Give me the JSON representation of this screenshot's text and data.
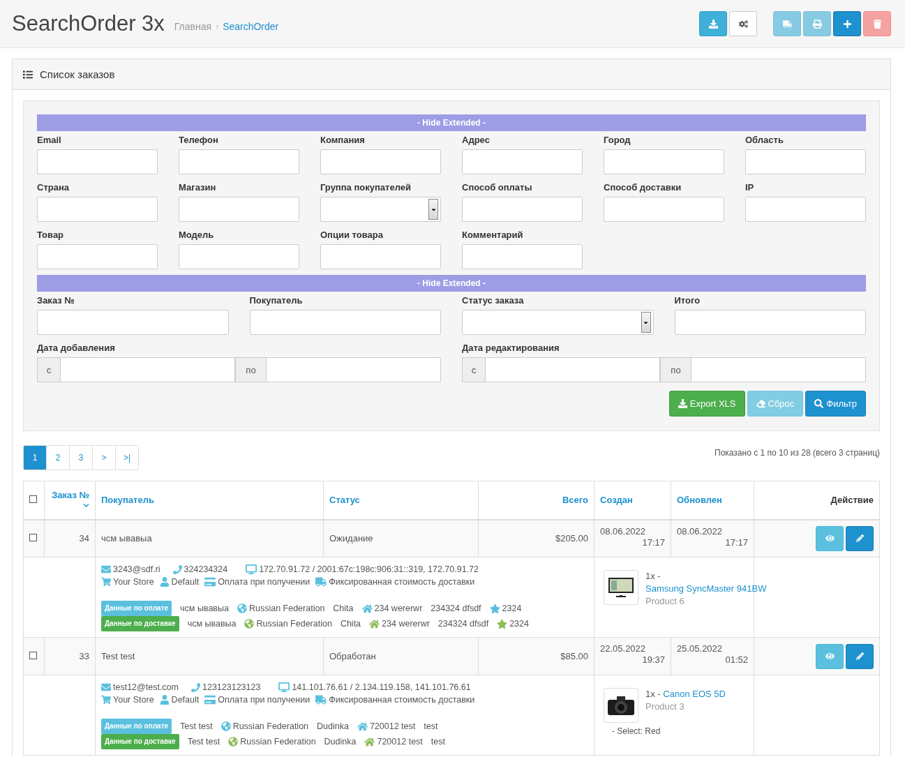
{
  "header": {
    "title": "SearchOrder 3x",
    "breadcrumbs": [
      {
        "label": "Главная",
        "current": false
      },
      {
        "label": "SearchOrder",
        "current": true
      }
    ],
    "separator": "›",
    "toolbar": [
      {
        "kind": "download",
        "disabled": false
      },
      {
        "kind": "settings",
        "disabled": false
      },
      {
        "kind": "shipping",
        "disabled": true
      },
      {
        "kind": "print",
        "disabled": true
      },
      {
        "kind": "add",
        "disabled": false
      },
      {
        "kind": "delete",
        "disabled": true
      }
    ]
  },
  "panel": {
    "title": "Список заказов"
  },
  "filter": {
    "toggles": [
      "- Hide Extended -",
      "- Hide Extended -"
    ],
    "extended_fields": [
      {
        "label": "Email",
        "kind": "text"
      },
      {
        "label": "Телефон",
        "kind": "text"
      },
      {
        "label": "Компания",
        "kind": "text"
      },
      {
        "label": "Адрес",
        "kind": "text"
      },
      {
        "label": "Город",
        "kind": "text"
      },
      {
        "label": "Область",
        "kind": "text"
      },
      {
        "label": "Страна",
        "kind": "text"
      },
      {
        "label": "Магазин",
        "kind": "text"
      },
      {
        "label": "Группа покупателей",
        "kind": "select"
      },
      {
        "label": "Способ оплаты",
        "kind": "text"
      },
      {
        "label": "Способ доставки",
        "kind": "text"
      },
      {
        "label": "IP",
        "kind": "text"
      },
      {
        "label": "Товар",
        "kind": "text"
      },
      {
        "label": "Модель",
        "kind": "text"
      },
      {
        "label": "Опции товара",
        "kind": "text"
      },
      {
        "label": "Комментарий",
        "kind": "text"
      }
    ],
    "main_fields": [
      {
        "label": "Заказ №",
        "kind": "text"
      },
      {
        "label": "Покупатель",
        "kind": "text"
      },
      {
        "label": "Статус заказа",
        "kind": "select"
      },
      {
        "label": "Итого",
        "kind": "text"
      }
    ],
    "date_ranges": [
      {
        "label": "Дата добавления",
        "from": "с",
        "to": "по"
      },
      {
        "label": "Дата редактирования",
        "from": "с",
        "to": "по"
      }
    ],
    "buttons": [
      {
        "kind": "export",
        "label": "Export XLS"
      },
      {
        "kind": "reset",
        "label": "Сброс"
      },
      {
        "kind": "filter",
        "label": "Фильтр"
      }
    ]
  },
  "pagination": {
    "pages": [
      {
        "label": "1",
        "selected": true
      },
      {
        "label": "2",
        "selected": false
      },
      {
        "label": "3",
        "selected": false
      },
      {
        "label": ">",
        "selected": false
      },
      {
        "label": ">|",
        "selected": false
      }
    ],
    "summary": "Показано с 1 по 10 из 28 (всего 3 страниц)"
  },
  "table": {
    "select_all": {
      "checked": false
    },
    "columns": [
      {
        "label": "Заказ №",
        "kind": "number",
        "sorted": true
      },
      {
        "label": "Покупатель",
        "kind": "text",
        "sorted": false
      },
      {
        "label": "Статус",
        "kind": "text",
        "sorted": false
      },
      {
        "label": "Всего",
        "kind": "number",
        "sorted": false
      },
      {
        "label": "Создан",
        "kind": "text",
        "sorted": false
      },
      {
        "label": "Обновлен",
        "kind": "text",
        "sorted": false
      },
      {
        "label": "Действие",
        "kind": "action",
        "sorted": false
      }
    ],
    "rows": [
      {
        "checked": false,
        "order_id": "34",
        "customer": "чсм ывавыа",
        "status": "Ожидание",
        "total": "$205.00",
        "created_date": "08.06.2022",
        "created_time": "17:17",
        "updated_date": "08.06.2022",
        "updated_time": "17:17",
        "email": "3243@sdf.ri",
        "phone": "324234324",
        "ip": "172.70.91.72 / 2001:67c:198c:906:31::319, 172.70.91.72",
        "store": "Your Store",
        "customer_group": "Default",
        "payment_method": "Оплата при получении",
        "shipping_method": "Фиксированная стоимость доставки",
        "addresses": [
          {
            "kind": "payment",
            "badge": "Данные по оплате",
            "name": "чсм ывавыа",
            "country": "Russian Federation",
            "city": "Chita",
            "address": "234 wererwr",
            "postcode": "234324 dfsdf",
            "zone": "2324"
          },
          {
            "kind": "shipping",
            "badge": "Данные по доставке",
            "name": "чсм ывавыа",
            "country": "Russian Federation",
            "city": "Chita",
            "address": "234 wererwr",
            "postcode": "234324 dfsdf",
            "zone": "2324"
          }
        ],
        "products": [
          {
            "kind": "monitor",
            "quantity": "1x -",
            "name": "Samsung SyncMaster 941BW",
            "model": "Product 6"
          }
        ]
      },
      {
        "checked": false,
        "order_id": "33",
        "customer": "Test test",
        "status": "Обработан",
        "total": "$85.00",
        "created_date": "22.05.2022",
        "created_time": "19:37",
        "updated_date": "25.05.2022",
        "updated_time": "01:52",
        "email": "test12@test.com",
        "phone": "123123123123",
        "ip": "141.101.76.61 / 2.134.119.158, 141.101.76.61",
        "store": "Your Store",
        "customer_group": "Default",
        "payment_method": "Оплата при получении",
        "shipping_method": "Фиксированная стоимость доставки",
        "addresses": [
          {
            "kind": "payment",
            "badge": "Данные по оплате",
            "name": "Test test",
            "country": "Russian Federation",
            "city": "Dudinka",
            "address": "720012 test",
            "postcode": "test"
          },
          {
            "kind": "shipping",
            "badge": "Данные по доставке",
            "name": "Test test",
            "country": "Russian Federation",
            "city": "Dudinka",
            "address": "720012 test",
            "postcode": "test"
          }
        ],
        "products": [
          {
            "kind": "camera",
            "quantity": "1x -",
            "name": "Canon EOS 5D",
            "model": "Product 3",
            "options": [
              "- Select: Red"
            ]
          }
        ]
      }
    ]
  }
}
